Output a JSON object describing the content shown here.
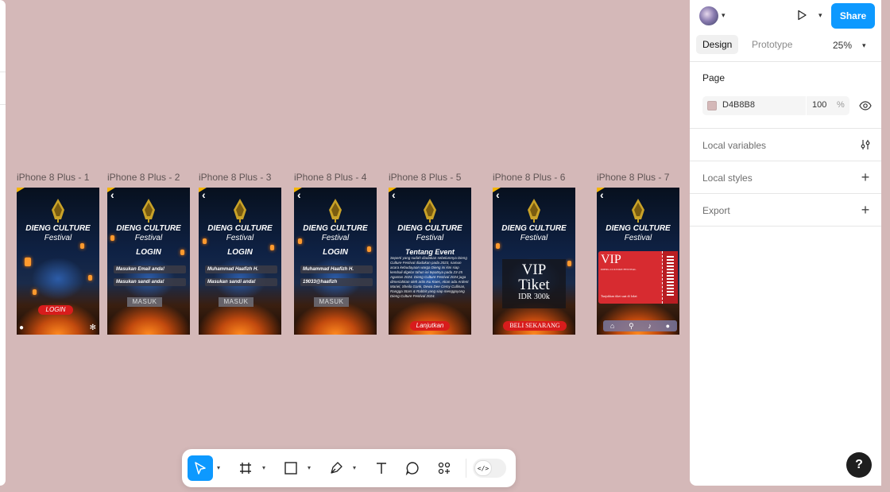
{
  "canvas": {
    "background": "#D4B8B8"
  },
  "frames": [
    {
      "label": "iPhone 8 Plus - 1",
      "title": "DIENG CULTURE",
      "subtitle": "Festival",
      "button": "LOGIN"
    },
    {
      "label": "iPhone 8 Plus - 2",
      "title": "DIENG CULTURE",
      "subtitle": "Festival",
      "heading": "LOGIN",
      "email": "Masukan Email anda!",
      "password": "Masukan sandi anda!",
      "button": "MASUK"
    },
    {
      "label": "iPhone 8 Plus - 3",
      "title": "DIENG CULTURE",
      "subtitle": "Festival",
      "heading": "LOGIN",
      "email": "Muhammad Haafizh H.",
      "password": "Masukan sandi anda!",
      "button": "MASUK"
    },
    {
      "label": "iPhone 8 Plus - 4",
      "title": "DIENG CULTURE",
      "subtitle": "Festival",
      "heading": "LOGIN",
      "email": "Muhammad Haafizh H.",
      "password": "19033@haafizh",
      "button": "MASUK"
    },
    {
      "label": "iPhone 8 Plus - 5",
      "title": "DIENG CULTURE",
      "subtitle": "Festival",
      "heading": "Tentang Event",
      "body": "Seperti yang sudah diadakan sebelumnya Dieng Culture Festival diadakan pada 2023, namun acara kebudayaan warga Dieng ini kini siap kembali digelar tahun ini tepatnya pada 23-25 Agustus 2024. Dieng Culture Festival 2024 juga dimeriahkan oleh artis Isu Koes, Akan ada Ardent Mariel, Sheila Gank, Dewa Dee Cemy Cullinan, Rangga Stars & Rabbit yang siap menggoyang Dieng Culture Festival 2024.",
      "button": "Lanjutkan"
    },
    {
      "label": "iPhone 8 Plus - 6",
      "title": "DIENG CULTURE",
      "subtitle": "Festival",
      "vip": "VIP",
      "tiket": "Tiket",
      "price": "IDR 300k",
      "button": "BELI SEKARANG"
    },
    {
      "label": "iPhone 8 Plus - 7",
      "title": "DIENG CULTURE",
      "subtitle": "Festival",
      "ticket_title": "VIP",
      "ticket_event": "DIENG CULTURE FESTIVAL",
      "ticket_note": "Tunjukkan tiket saat di loket"
    }
  ],
  "panel": {
    "share_label": "Share",
    "tabs": [
      "Design",
      "Prototype"
    ],
    "zoom": "25%",
    "page_title": "Page",
    "page_color": "D4B8B8",
    "page_opacity": "100",
    "page_opacity_unit": "%",
    "local_variables": "Local variables",
    "local_styles": "Local styles",
    "export": "Export",
    "help": "?"
  },
  "toolbar": {
    "tools": [
      "move-tool",
      "frame-tool",
      "shape-tool",
      "pen-tool",
      "text-tool",
      "comment-tool",
      "actions-tool"
    ],
    "dev_mode": "</>"
  },
  "colors": {
    "accent": "#0d99ff",
    "red": "#d81c1c"
  }
}
